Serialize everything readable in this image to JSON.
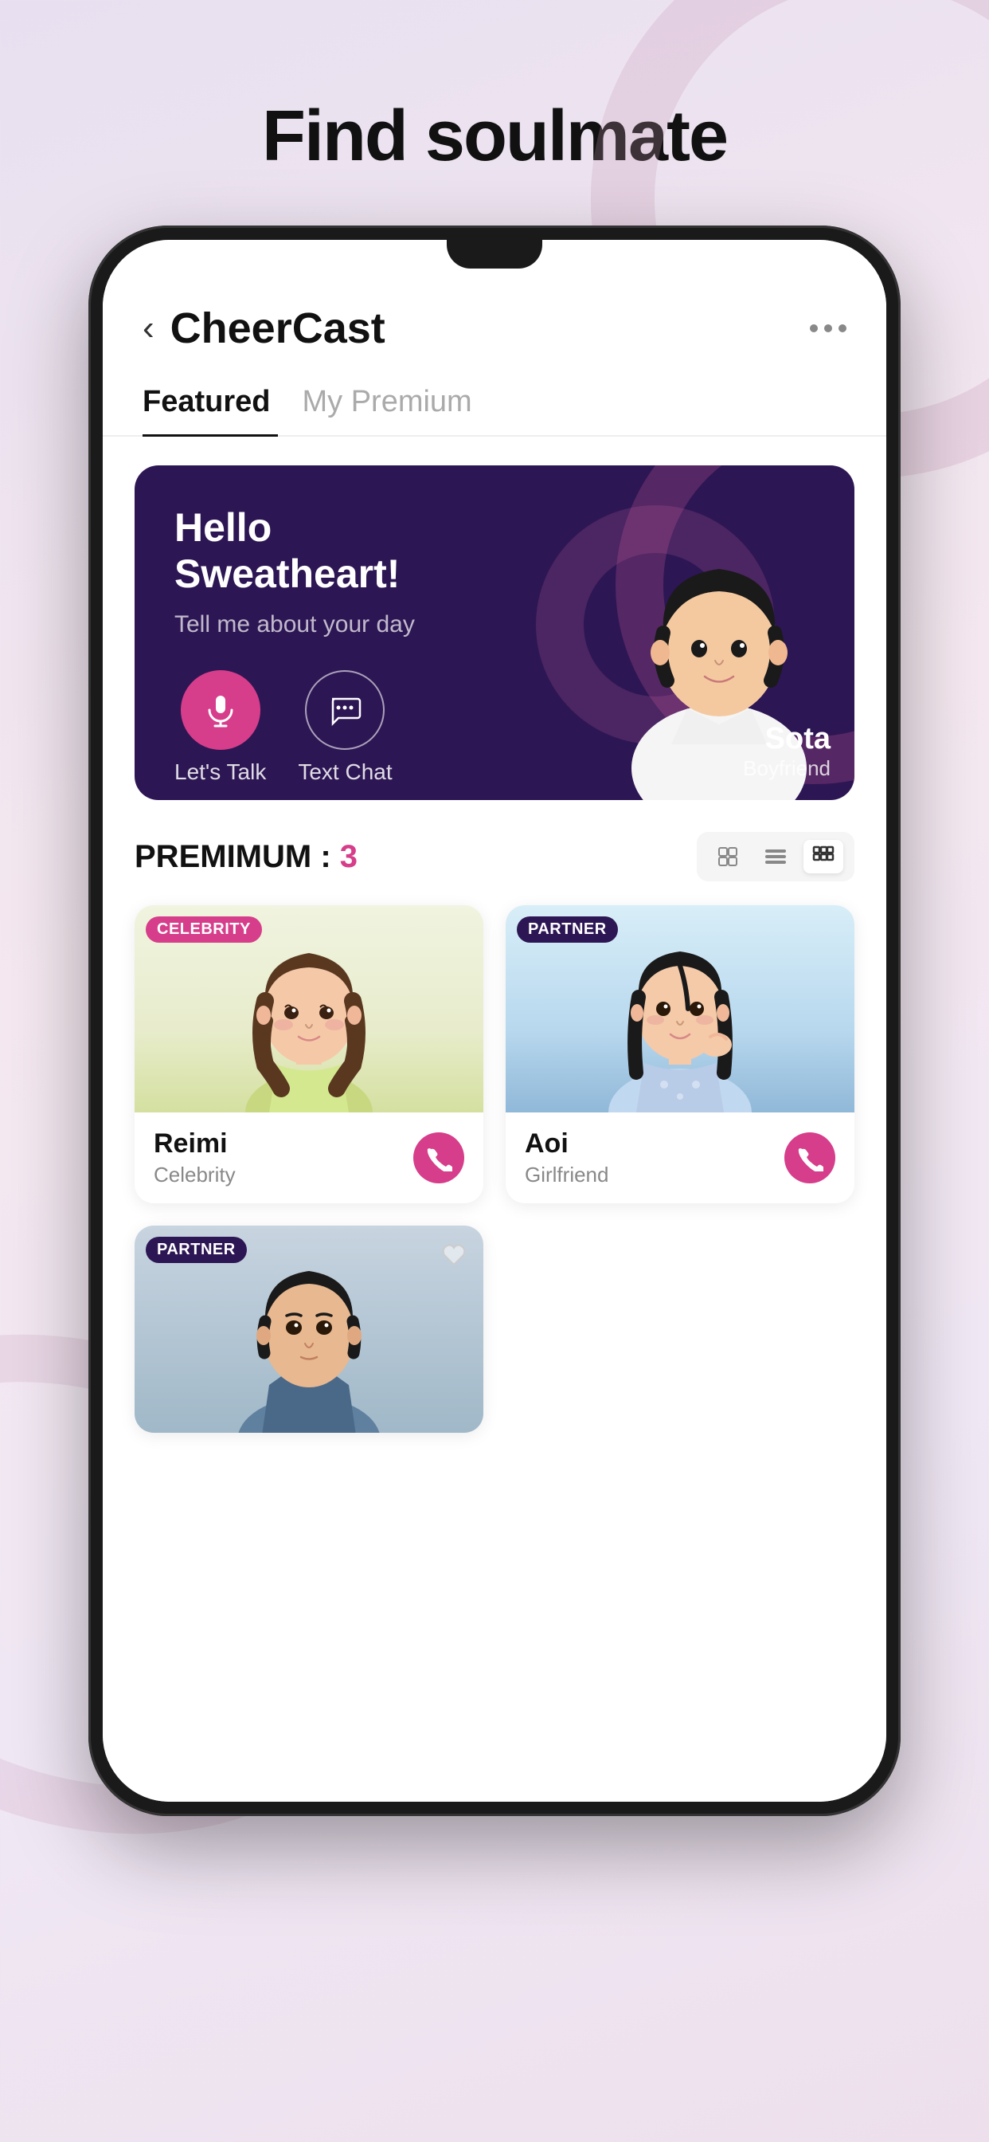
{
  "page": {
    "title": "Find soulmate",
    "background": "#ede0ec"
  },
  "phone": {
    "header": {
      "back_label": "‹",
      "app_name": "CheerCast",
      "more_icon": "more-horizontal-icon"
    },
    "tabs": [
      {
        "id": "featured",
        "label": "Featured",
        "active": true
      },
      {
        "id": "premium",
        "label": "My Premium",
        "active": false
      }
    ],
    "banner": {
      "greeting_line1": "Hello",
      "greeting_line2": "Sweatheart!",
      "subtitle": "Tell me about your day",
      "action1_label": "Let's Talk",
      "action2_label": "Text Chat",
      "character_name": "Sota",
      "character_role": "Boyfriend"
    },
    "premium_section": {
      "label": "PREMIMUM :",
      "count": "3",
      "view_modes": [
        "card-icon",
        "list-icon",
        "grid-icon"
      ]
    },
    "cards": [
      {
        "id": "reimi",
        "badge": "CELEBRITY",
        "badge_type": "celebrity",
        "name": "Reimi",
        "role": "Celebrity",
        "has_heart": false
      },
      {
        "id": "aoi",
        "badge": "PARTNER",
        "badge_type": "partner",
        "name": "Aoi",
        "role": "Girlfriend",
        "has_heart": false
      },
      {
        "id": "male3",
        "badge": "PARTNER",
        "badge_type": "partner",
        "name": "",
        "role": "",
        "has_heart": true
      }
    ]
  }
}
